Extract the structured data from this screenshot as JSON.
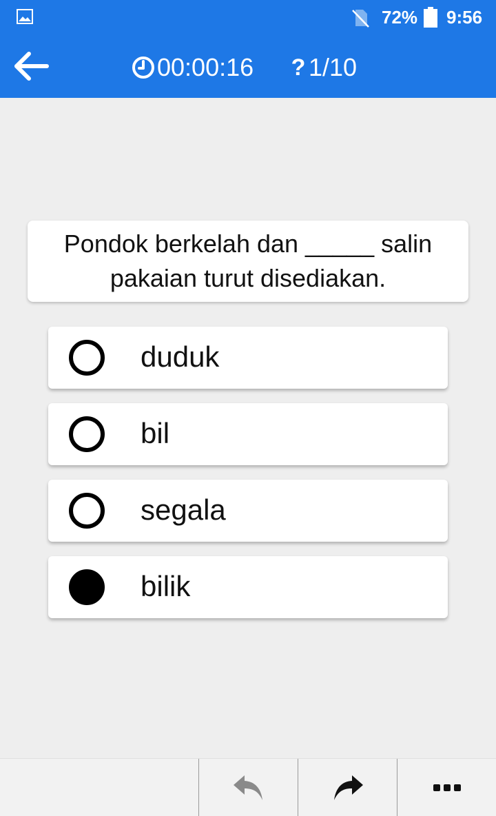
{
  "status_bar": {
    "battery_percent": "72%",
    "time": "9:56",
    "icons": [
      "image-icon",
      "no-sim-icon",
      "battery-icon"
    ]
  },
  "app_bar": {
    "timer": "00:00:16",
    "progress": "1/10",
    "icons": [
      "back-arrow-icon",
      "clock-icon",
      "question-mark-icon"
    ]
  },
  "question": {
    "text": "Pondok berkelah dan _____ salin pakaian turut disediakan."
  },
  "options": [
    {
      "label": "duduk",
      "selected": false
    },
    {
      "label": "bil",
      "selected": false
    },
    {
      "label": "segala",
      "selected": false
    },
    {
      "label": "bilik",
      "selected": true
    }
  ],
  "bottom_bar": {
    "icons": [
      "undo-icon",
      "redo-icon",
      "more-icon"
    ]
  },
  "colors": {
    "accent": "#1e78e6",
    "background": "#eeeeee",
    "card": "#ffffff"
  }
}
